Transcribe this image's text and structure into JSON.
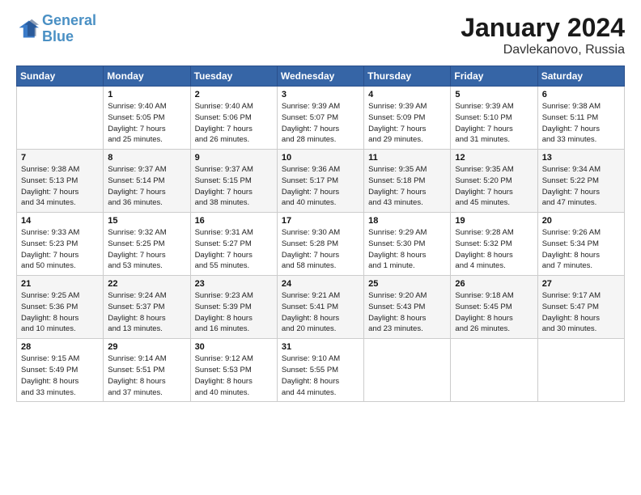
{
  "logo": {
    "line1": "General",
    "line2": "Blue"
  },
  "title": "January 2024",
  "subtitle": "Davlekanovo, Russia",
  "days_header": [
    "Sunday",
    "Monday",
    "Tuesday",
    "Wednesday",
    "Thursday",
    "Friday",
    "Saturday"
  ],
  "weeks": [
    [
      {
        "day": "",
        "info": ""
      },
      {
        "day": "1",
        "info": "Sunrise: 9:40 AM\nSunset: 5:05 PM\nDaylight: 7 hours\nand 25 minutes."
      },
      {
        "day": "2",
        "info": "Sunrise: 9:40 AM\nSunset: 5:06 PM\nDaylight: 7 hours\nand 26 minutes."
      },
      {
        "day": "3",
        "info": "Sunrise: 9:39 AM\nSunset: 5:07 PM\nDaylight: 7 hours\nand 28 minutes."
      },
      {
        "day": "4",
        "info": "Sunrise: 9:39 AM\nSunset: 5:09 PM\nDaylight: 7 hours\nand 29 minutes."
      },
      {
        "day": "5",
        "info": "Sunrise: 9:39 AM\nSunset: 5:10 PM\nDaylight: 7 hours\nand 31 minutes."
      },
      {
        "day": "6",
        "info": "Sunrise: 9:38 AM\nSunset: 5:11 PM\nDaylight: 7 hours\nand 33 minutes."
      }
    ],
    [
      {
        "day": "7",
        "info": "Sunrise: 9:38 AM\nSunset: 5:13 PM\nDaylight: 7 hours\nand 34 minutes."
      },
      {
        "day": "8",
        "info": "Sunrise: 9:37 AM\nSunset: 5:14 PM\nDaylight: 7 hours\nand 36 minutes."
      },
      {
        "day": "9",
        "info": "Sunrise: 9:37 AM\nSunset: 5:15 PM\nDaylight: 7 hours\nand 38 minutes."
      },
      {
        "day": "10",
        "info": "Sunrise: 9:36 AM\nSunset: 5:17 PM\nDaylight: 7 hours\nand 40 minutes."
      },
      {
        "day": "11",
        "info": "Sunrise: 9:35 AM\nSunset: 5:18 PM\nDaylight: 7 hours\nand 43 minutes."
      },
      {
        "day": "12",
        "info": "Sunrise: 9:35 AM\nSunset: 5:20 PM\nDaylight: 7 hours\nand 45 minutes."
      },
      {
        "day": "13",
        "info": "Sunrise: 9:34 AM\nSunset: 5:22 PM\nDaylight: 7 hours\nand 47 minutes."
      }
    ],
    [
      {
        "day": "14",
        "info": "Sunrise: 9:33 AM\nSunset: 5:23 PM\nDaylight: 7 hours\nand 50 minutes."
      },
      {
        "day": "15",
        "info": "Sunrise: 9:32 AM\nSunset: 5:25 PM\nDaylight: 7 hours\nand 53 minutes."
      },
      {
        "day": "16",
        "info": "Sunrise: 9:31 AM\nSunset: 5:27 PM\nDaylight: 7 hours\nand 55 minutes."
      },
      {
        "day": "17",
        "info": "Sunrise: 9:30 AM\nSunset: 5:28 PM\nDaylight: 7 hours\nand 58 minutes."
      },
      {
        "day": "18",
        "info": "Sunrise: 9:29 AM\nSunset: 5:30 PM\nDaylight: 8 hours\nand 1 minute."
      },
      {
        "day": "19",
        "info": "Sunrise: 9:28 AM\nSunset: 5:32 PM\nDaylight: 8 hours\nand 4 minutes."
      },
      {
        "day": "20",
        "info": "Sunrise: 9:26 AM\nSunset: 5:34 PM\nDaylight: 8 hours\nand 7 minutes."
      }
    ],
    [
      {
        "day": "21",
        "info": "Sunrise: 9:25 AM\nSunset: 5:36 PM\nDaylight: 8 hours\nand 10 minutes."
      },
      {
        "day": "22",
        "info": "Sunrise: 9:24 AM\nSunset: 5:37 PM\nDaylight: 8 hours\nand 13 minutes."
      },
      {
        "day": "23",
        "info": "Sunrise: 9:23 AM\nSunset: 5:39 PM\nDaylight: 8 hours\nand 16 minutes."
      },
      {
        "day": "24",
        "info": "Sunrise: 9:21 AM\nSunset: 5:41 PM\nDaylight: 8 hours\nand 20 minutes."
      },
      {
        "day": "25",
        "info": "Sunrise: 9:20 AM\nSunset: 5:43 PM\nDaylight: 8 hours\nand 23 minutes."
      },
      {
        "day": "26",
        "info": "Sunrise: 9:18 AM\nSunset: 5:45 PM\nDaylight: 8 hours\nand 26 minutes."
      },
      {
        "day": "27",
        "info": "Sunrise: 9:17 AM\nSunset: 5:47 PM\nDaylight: 8 hours\nand 30 minutes."
      }
    ],
    [
      {
        "day": "28",
        "info": "Sunrise: 9:15 AM\nSunset: 5:49 PM\nDaylight: 8 hours\nand 33 minutes."
      },
      {
        "day": "29",
        "info": "Sunrise: 9:14 AM\nSunset: 5:51 PM\nDaylight: 8 hours\nand 37 minutes."
      },
      {
        "day": "30",
        "info": "Sunrise: 9:12 AM\nSunset: 5:53 PM\nDaylight: 8 hours\nand 40 minutes."
      },
      {
        "day": "31",
        "info": "Sunrise: 9:10 AM\nSunset: 5:55 PM\nDaylight: 8 hours\nand 44 minutes."
      },
      {
        "day": "",
        "info": ""
      },
      {
        "day": "",
        "info": ""
      },
      {
        "day": "",
        "info": ""
      }
    ]
  ]
}
